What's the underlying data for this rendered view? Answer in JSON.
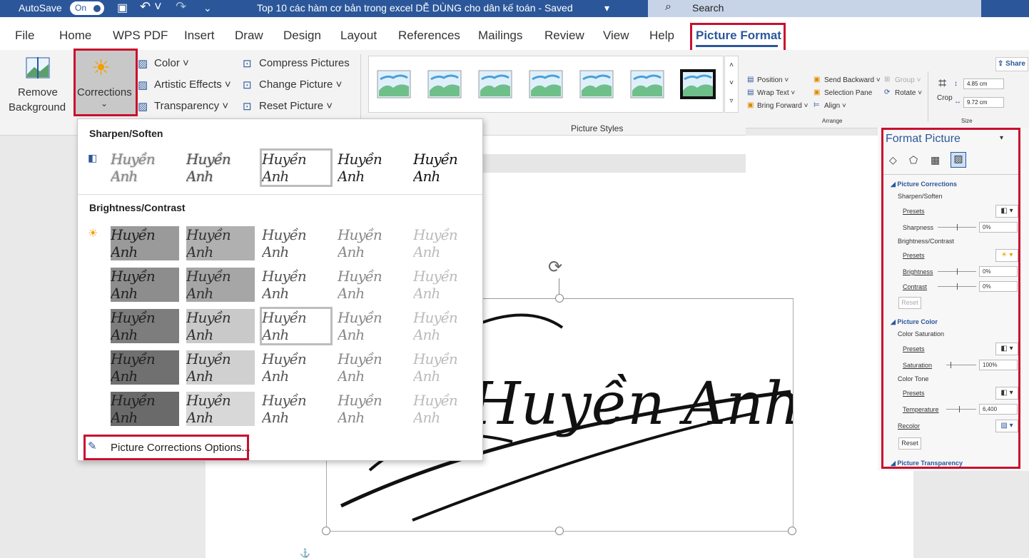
{
  "titlebar": {
    "autosave_label": "AutoSave",
    "autosave_state": "On",
    "title": "Top 10 các hàm cơ bản trong excel DỄ DÙNG cho dân kế toán  -  Saved",
    "search_placeholder": "Search"
  },
  "tabs": [
    "File",
    "Home",
    "WPS PDF",
    "Insert",
    "Draw",
    "Design",
    "Layout",
    "References",
    "Mailings",
    "Review",
    "View",
    "Help",
    "Picture Format"
  ],
  "ribbon": {
    "remove_bg_line1": "Remove",
    "remove_bg_line2": "Background",
    "corrections": "Corrections",
    "color": "Color ˅",
    "artistic": "Artistic Effects ˅",
    "transparency": "Transparency ˅",
    "compress": "Compress Pictures",
    "change": "Change Picture ˅",
    "reset": "Reset Picture  ˅",
    "picture_styles": "Picture Styles",
    "position": "Position ˅",
    "wrap_text": "Wrap Text ˅",
    "bring_forward": "Bring Forward  ˅",
    "send_backward": "Send Backward  ˅",
    "selection_pane": "Selection Pane",
    "align": "Align ˅",
    "group": "Group ˅",
    "rotate": "Rotate ˅",
    "arrange": "Arrange",
    "crop": "Crop",
    "height": "4.85 cm",
    "width": "9.72 cm",
    "size": "Size",
    "share": "Share"
  },
  "dropdown": {
    "sharpen_title": "Sharpen/Soften",
    "brightness_title": "Brightness/Contrast",
    "options_link": "Picture Corrections Options..."
  },
  "signature_text": "Huyền Anh",
  "panel": {
    "title": "Format Picture",
    "corrections_hdr": "Picture Corrections",
    "sharpen_soften": "Sharpen/Soften",
    "presets": "Presets",
    "sharpness": "Sharpness",
    "sharpness_val": "0%",
    "brightness_contrast": "Brightness/Contrast",
    "brightness": "Brightness",
    "brightness_val": "0%",
    "contrast": "Contrast",
    "contrast_val": "0%",
    "reset": "Reset",
    "color_hdr": "Picture Color",
    "color_saturation": "Color Saturation",
    "saturation": "Saturation",
    "saturation_val": "100%",
    "color_tone": "Color Tone",
    "temperature": "Temperature",
    "temperature_val": "6,400",
    "recolor": "Recolor",
    "transparency_hdr": "Picture Transparency"
  },
  "colors": {
    "accent": "#2b579a",
    "highlight": "#c8102e"
  }
}
